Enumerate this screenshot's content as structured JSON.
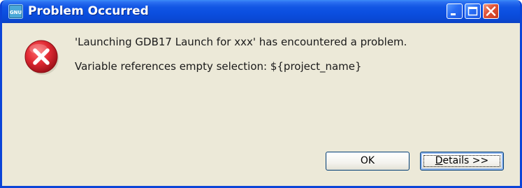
{
  "window": {
    "title": "Problem Occurred",
    "app_icon_text": "GNU"
  },
  "title_buttons": {
    "minimize_icon": "minimize-icon",
    "maximize_icon": "maximize-icon",
    "close_icon": "close-icon"
  },
  "dialog": {
    "icon": "error-icon",
    "message_line1": "'Launching GDB17 Launch for xxx' has encountered a problem.",
    "message_line2": "Variable references empty selection: ${project_name}"
  },
  "buttons": {
    "ok_label": "OK",
    "details_mnemonic": "D",
    "details_rest": "etails >>"
  },
  "colors": {
    "titlebar": "#0b4fe0",
    "window_border": "#0b44d8",
    "dialog_background": "#ece9d8",
    "error_red": "#d8242f",
    "close_button": "#e0553a"
  }
}
